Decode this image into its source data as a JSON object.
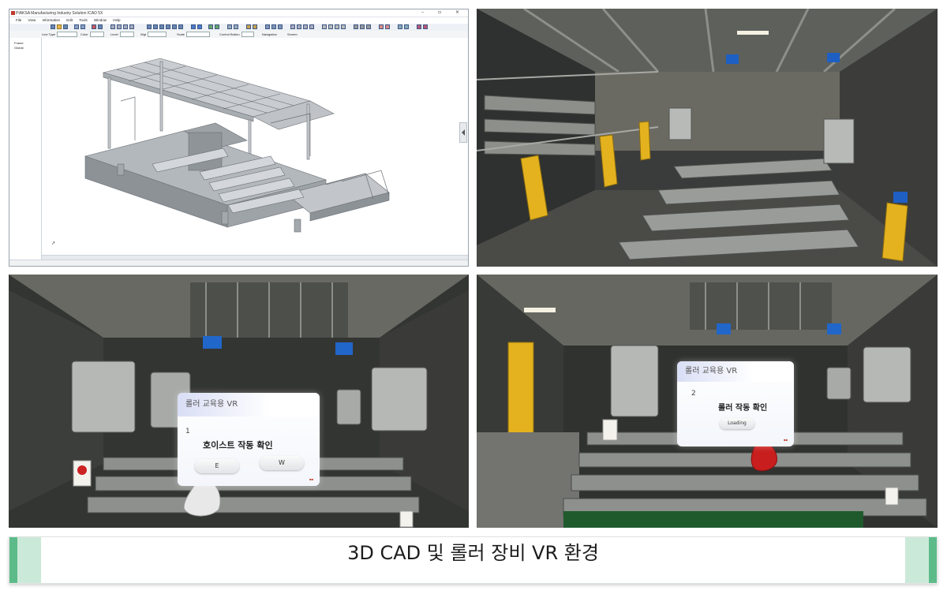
{
  "cad_window": {
    "title": "PIAKSA Manufacturing Industry Solution ICAD 5X",
    "window_controls": "– ▫ ×",
    "menu": [
      "File",
      "View",
      "Information",
      "Edit",
      "Tools",
      "Window",
      "Help"
    ],
    "props": {
      "layer_label": "Line Type",
      "color_label": "Color",
      "level_label": "Level",
      "weight_label": "Wgt",
      "scale_label": "Scale",
      "control_label": "Control Button",
      "nav_label": "Navigation",
      "snap_label": "Screen"
    },
    "tree": [
      "Frame",
      "Global"
    ]
  },
  "vr1": {
    "header": "롤러 교육용 VR",
    "step": "1",
    "task": "호이스트 작동 확인",
    "buttons": [
      "E",
      "W"
    ]
  },
  "vr2": {
    "header": "롤러 교육용 VR",
    "step": "2",
    "task": "롤러 작동 확인",
    "buttons": [
      "Loading"
    ]
  },
  "caption": "3D CAD 및 롤러 장비 VR 환경",
  "colors": {
    "caption_accent": "#5dbb8a",
    "caption_accent_light": "#cbe9d8",
    "hand_red": "#c81e1e",
    "safety_yellow": "#e3b21e"
  }
}
